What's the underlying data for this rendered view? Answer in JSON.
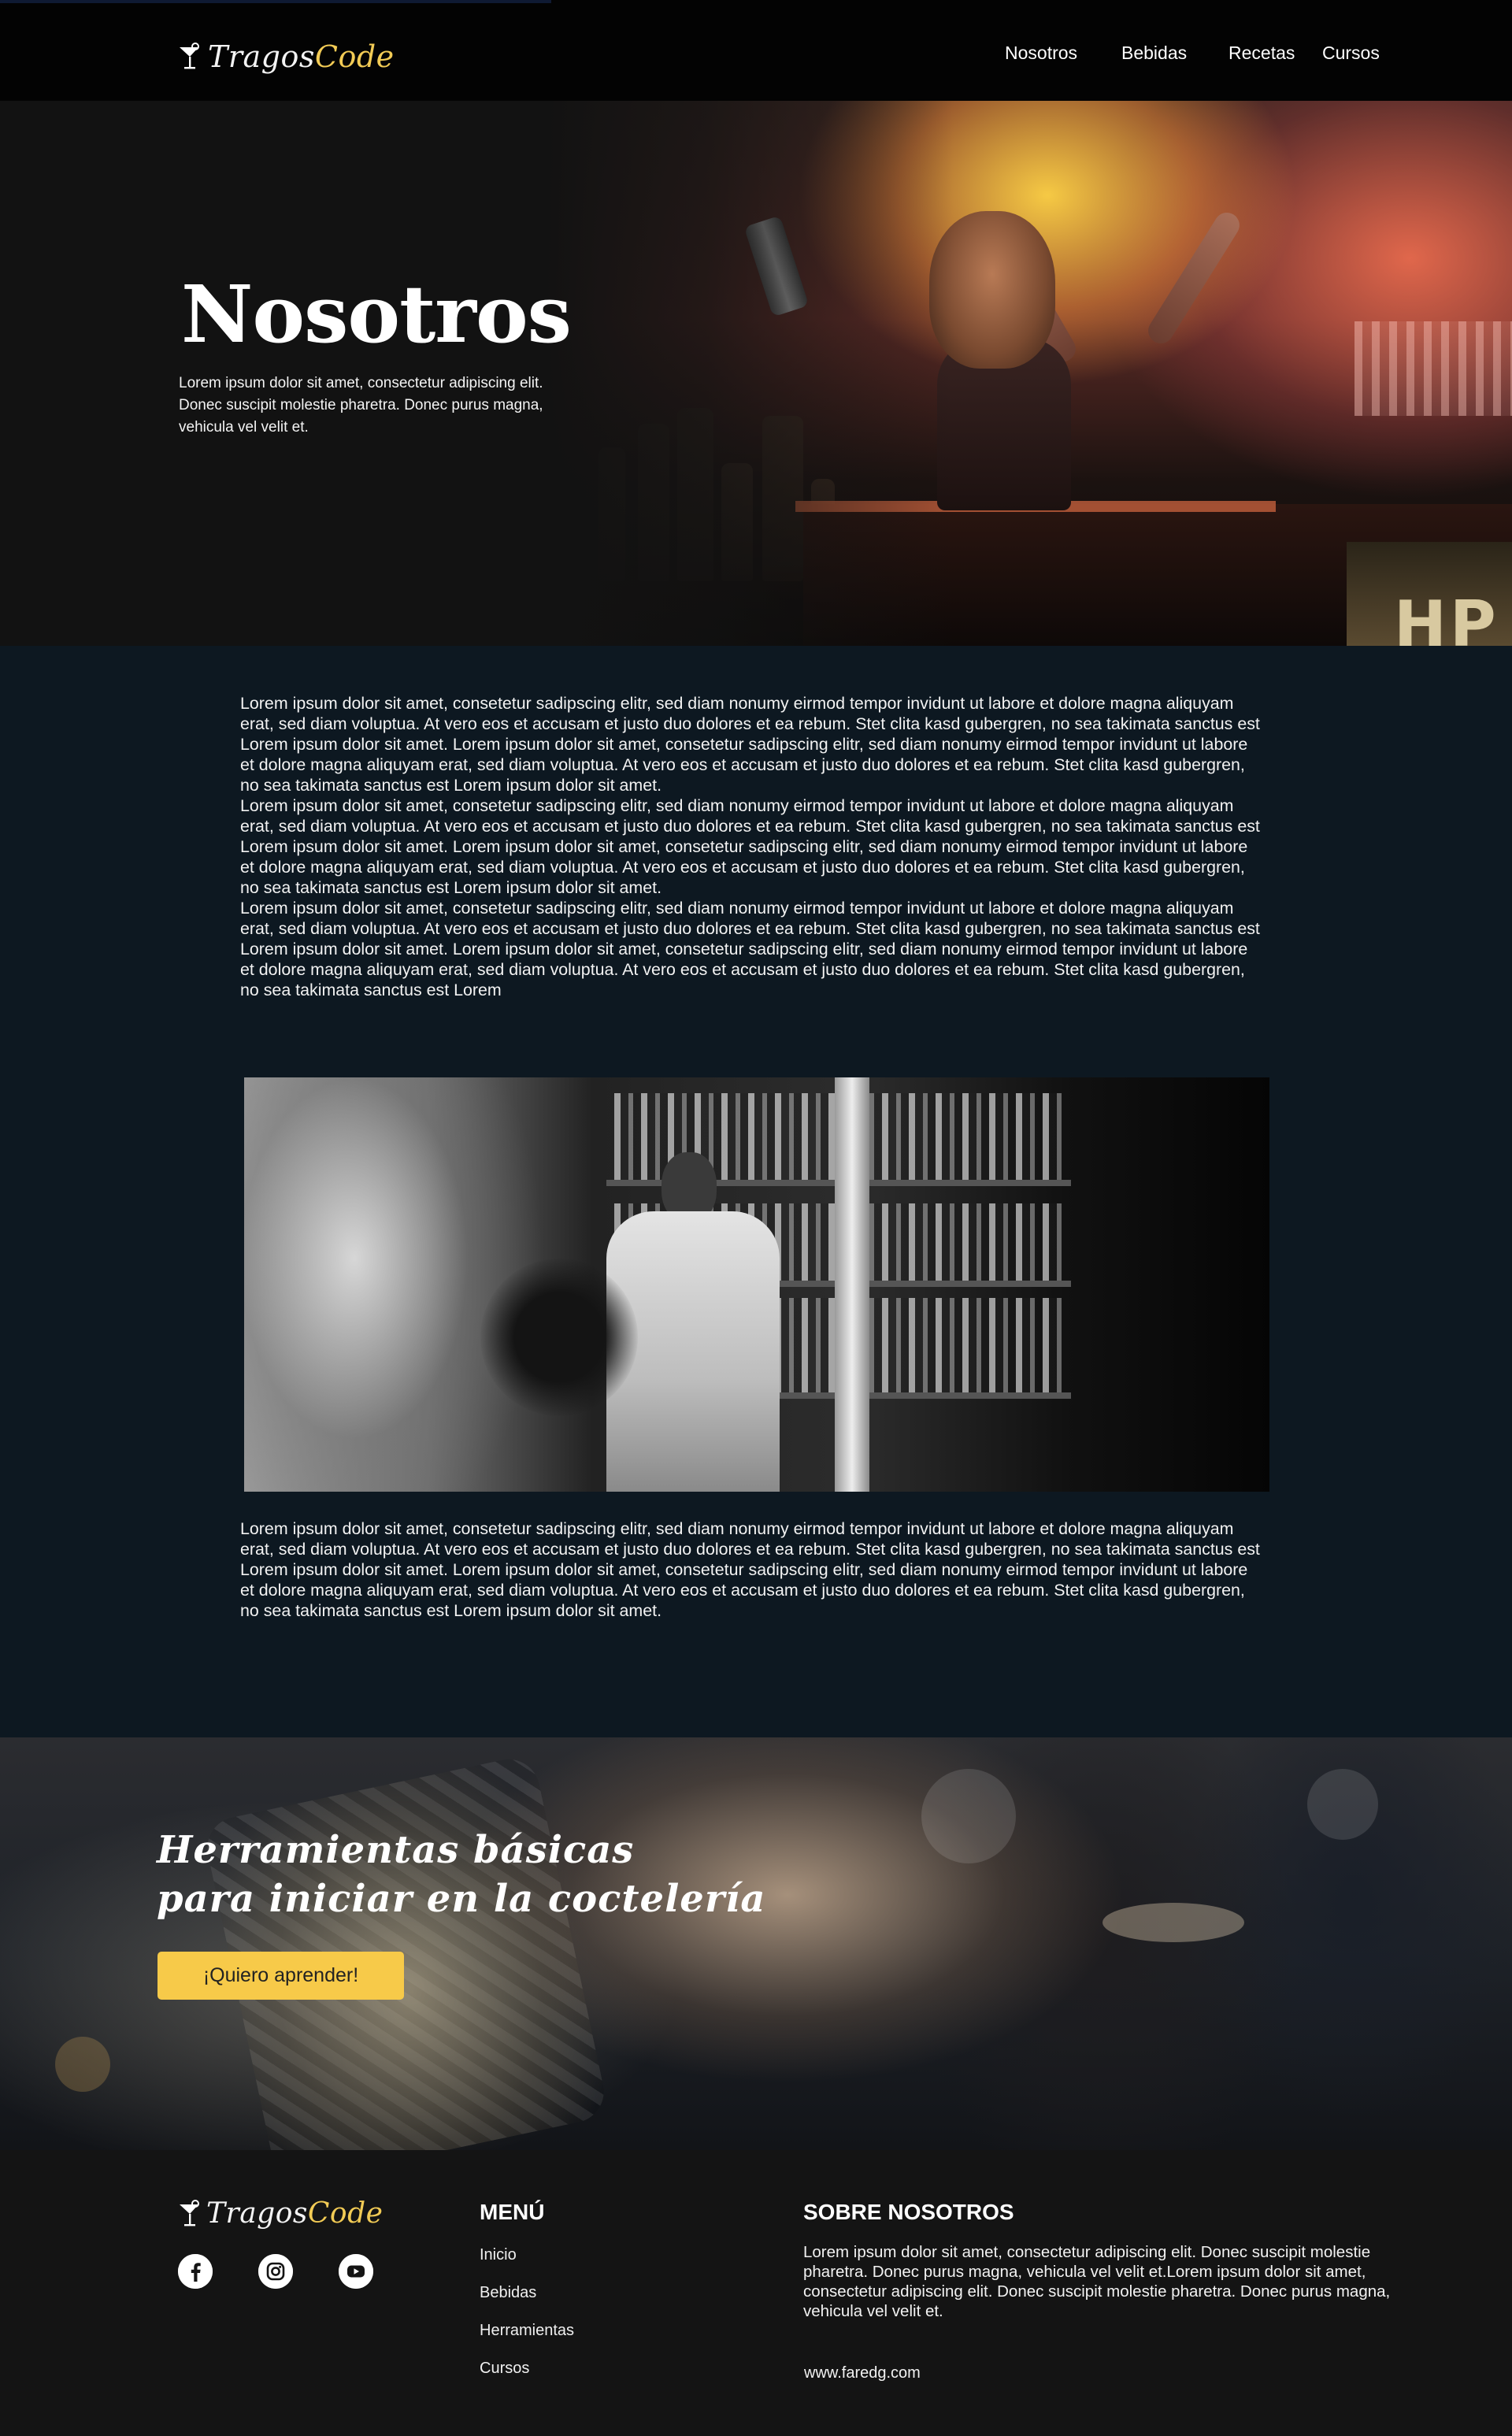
{
  "nav": {
    "brand_part1": "Tragos",
    "brand_part2": "Code",
    "links": [
      "Nosotros",
      "Bebidas",
      "Recetas",
      "Cursos"
    ]
  },
  "hero": {
    "title": "Nosotros",
    "description": "Lorem ipsum dolor sit amet, consectetur adipiscing elit. Donec suscipit molestie pharetra. Donec purus magna, vehicula vel velit et.",
    "sign_text": "HP"
  },
  "content": {
    "paragraphs_top": [
      "Lorem ipsum dolor sit amet, consetetur sadipscing elitr, sed diam nonumy eirmod tempor invidunt ut labore et dolore magna aliquyam erat, sed diam voluptua. At vero eos et accusam et justo duo dolores et ea rebum. Stet clita kasd gubergren, no sea takimata sanctus est Lorem ipsum dolor sit amet. Lorem ipsum dolor sit amet, consetetur sadipscing elitr, sed diam nonumy eirmod tempor invidunt ut labore et dolore magna aliquyam erat, sed diam voluptua. At vero eos et accusam et justo duo dolores et ea rebum. Stet clita kasd gubergren, no sea takimata sanctus est Lorem ipsum dolor sit amet.",
      "Lorem ipsum dolor sit amet, consetetur sadipscing elitr, sed diam nonumy eirmod tempor invidunt ut labore et dolore magna aliquyam erat, sed diam voluptua. At vero eos et accusam et justo duo dolores et ea rebum. Stet clita kasd gubergren, no sea takimata sanctus est Lorem ipsum dolor sit amet. Lorem ipsum dolor sit amet, consetetur sadipscing elitr, sed diam nonumy eirmod tempor invidunt ut labore et dolore magna aliquyam erat, sed diam voluptua. At vero eos et accusam et justo duo dolores et ea rebum. Stet clita kasd gubergren, no sea takimata sanctus est Lorem ipsum dolor sit amet.",
      "Lorem ipsum dolor sit amet, consetetur sadipscing elitr, sed diam nonumy eirmod tempor invidunt ut labore et dolore magna aliquyam erat, sed diam voluptua. At vero eos et accusam et justo duo dolores et ea rebum. Stet clita kasd gubergren, no sea takimata sanctus est Lorem ipsum dolor sit amet. Lorem ipsum dolor sit amet, consetetur sadipscing elitr, sed diam nonumy eirmod tempor invidunt ut labore et dolore magna aliquyam erat, sed diam voluptua. At vero eos et accusam et justo duo dolores et ea rebum. Stet clita kasd gubergren, no sea takimata sanctus est Lorem"
    ],
    "paragraph_bottom": "Lorem ipsum dolor sit amet, consetetur sadipscing elitr, sed diam nonumy eirmod tempor invidunt ut labore et dolore magna aliquyam erat, sed diam voluptua. At vero eos et accusam et justo duo dolores et ea rebum. Stet clita kasd gubergren, no sea takimata sanctus est Lorem ipsum dolor sit amet. Lorem ipsum dolor sit amet, consetetur sadipscing elitr, sed diam nonumy eirmod tempor invidunt ut labore et dolore magna aliquyam erat, sed diam voluptua. At vero eos et accusam et justo duo dolores et ea rebum. Stet clita kasd gubergren, no sea takimata sanctus est Lorem ipsum dolor sit amet."
  },
  "cta": {
    "title_line1": "Herramientas básicas",
    "title_line2": "para iniciar en la coctelería",
    "button_label": "¡Quiero aprender!"
  },
  "footer": {
    "brand_part1": "Tragos",
    "brand_part2": "Code",
    "socials": [
      "facebook-icon",
      "instagram-icon",
      "youtube-icon"
    ],
    "menu_heading": "MENÚ",
    "menu_items": [
      "Inicio",
      "Bebidas",
      "Herramientas",
      "Cursos"
    ],
    "about_heading": "SOBRE NOSOTROS",
    "about_text": "Lorem ipsum dolor sit amet, consectetur adipiscing elit. Donec suscipit molestie pharetra. Donec purus magna, vehicula vel velit et.Lorem ipsum dolor sit amet, consectetur adipiscing elit. Donec suscipit molestie pharetra. Donec purus magna, vehicula vel velit et.",
    "url": "www.faredg.com"
  },
  "colors": {
    "accent": "#f2cb55",
    "button": "#f7ca49",
    "content_bg": "#0d1821",
    "nav_bg": "#030303",
    "footer_bg": "#141414"
  }
}
